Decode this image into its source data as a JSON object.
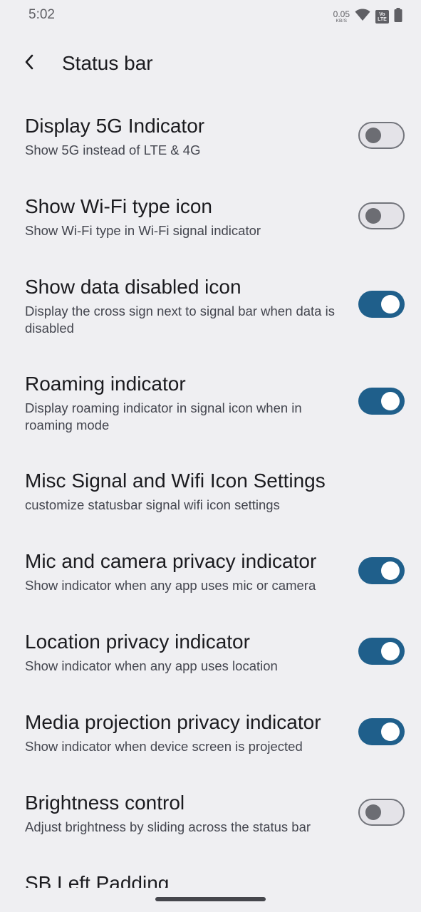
{
  "status_bar": {
    "time": "5:02",
    "net_speed": "0.05",
    "net_speed_unit": "KB/S",
    "volte_top": "Vo",
    "volte_bottom": "LTE",
    "icons": [
      "wifi-icon",
      "volte-icon",
      "battery-icon"
    ]
  },
  "app_bar": {
    "title": "Status bar",
    "back_icon": "back-arrow-icon"
  },
  "settings": [
    {
      "title": "Display 5G Indicator",
      "summary": "Show 5G instead of LTE & 4G",
      "toggle": "off"
    },
    {
      "title": "Show Wi-Fi type icon",
      "summary": "Show Wi-Fi type in Wi-Fi signal indicator",
      "toggle": "off"
    },
    {
      "title": "Show data disabled icon",
      "summary": "Display the cross sign next to signal bar when data is disabled",
      "toggle": "on"
    },
    {
      "title": "Roaming indicator",
      "summary": "Display roaming indicator in signal icon when in roaming mode",
      "toggle": "on"
    },
    {
      "title": "Misc Signal and Wifi Icon Settings",
      "summary": "customize statusbar signal wifi icon settings",
      "toggle": null
    },
    {
      "title": "Mic and camera privacy indicator",
      "summary": "Show indicator when any app uses mic or camera",
      "toggle": "on"
    },
    {
      "title": "Location privacy indicator",
      "summary": "Show indicator when any app uses location",
      "toggle": "on"
    },
    {
      "title": "Media projection privacy indicator",
      "summary": "Show indicator when device screen is projected",
      "toggle": "on"
    },
    {
      "title": "Brightness control",
      "summary": "Adjust brightness by sliding across the status bar",
      "toggle": "off"
    },
    {
      "title": "SB Left Padding",
      "summary": "",
      "toggle": null
    }
  ],
  "colors": {
    "background": "#efeff2",
    "toggle_on": "#1f5f8b",
    "toggle_off_border": "#72747b",
    "text_primary": "#1b1b1f",
    "text_secondary": "#44464f"
  }
}
